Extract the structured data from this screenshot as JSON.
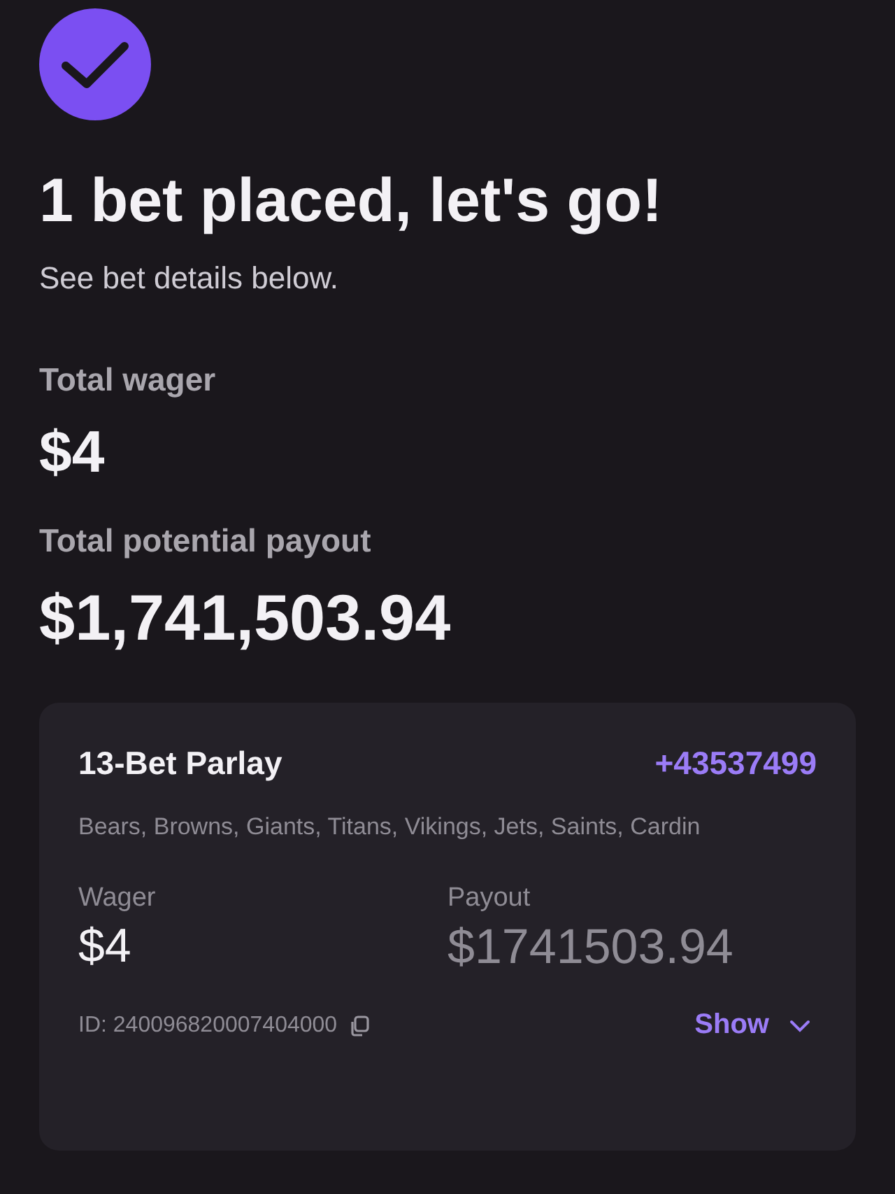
{
  "confirmation": {
    "title": "1 bet placed, let's go!",
    "subtitle": "See bet details below."
  },
  "totals": [
    {
      "label": "Total wager",
      "value": "$4"
    },
    {
      "label": "Total potential payout",
      "value": "$1,741,503.94"
    }
  ],
  "bet_card": {
    "title": "13-Bet Parlay",
    "odds": "+43537499",
    "teams": "Bears, Browns, Giants, Titans, Vikings, Jets, Saints, Cardin",
    "amounts": [
      {
        "label": "Wager",
        "value": "$4",
        "muted": false
      },
      {
        "label": "Payout",
        "value": "$1741503.94",
        "muted": true
      }
    ],
    "id": "ID: 240096820007404000",
    "show_button": "Show"
  }
}
